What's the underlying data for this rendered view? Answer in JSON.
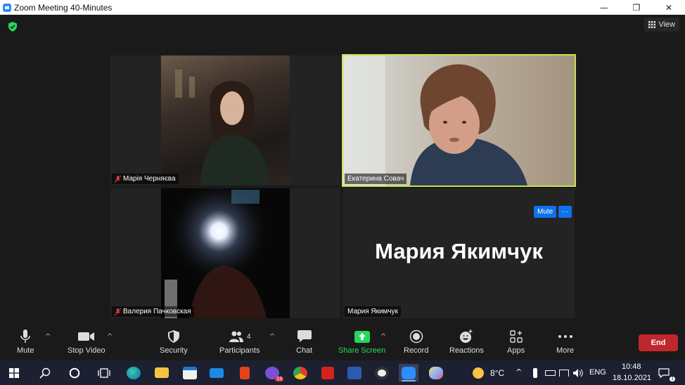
{
  "window": {
    "title": "Zoom Meeting 40-Minutes",
    "minimize_glyph": "—",
    "restore_glyph": "❐",
    "close_glyph": "✕"
  },
  "meeting": {
    "view_label": "View",
    "participants": [
      {
        "name": "Марія Черняєва",
        "muted": true
      },
      {
        "name": "Екатерина Совач",
        "muted": false,
        "active_speaker": true
      },
      {
        "name": "Валерия Пачковская",
        "muted": true
      },
      {
        "name": "Мария Якимчук",
        "muted": false,
        "video_off": true,
        "display_name": "Мария Якимчук"
      }
    ],
    "hover_mute_label": "Mute",
    "hover_more_label": "···",
    "accent_color": "#c7e34a"
  },
  "toolbar": {
    "mute": "Mute",
    "stop_video": "Stop Video",
    "security": "Security",
    "participants": "Participants",
    "participants_count": "4",
    "chat": "Chat",
    "share_screen": "Share Screen",
    "record": "Record",
    "reactions": "Reactions",
    "apps": "Apps",
    "more": "More",
    "end": "End"
  },
  "taskbar": {
    "viber_badge": "13",
    "weather": "8°C",
    "language": "ENG",
    "time": "10:48",
    "date": "18.10.2021",
    "notification_count": "1"
  }
}
